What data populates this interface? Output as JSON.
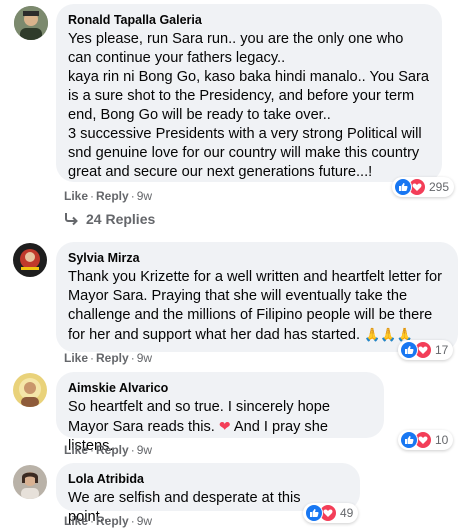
{
  "colors": {
    "bubble": "#f0f2f5",
    "meta_text": "#65676b",
    "like_blue": "#1877f2",
    "love_red": "#f33e58"
  },
  "comments": [
    {
      "author": "Ronald Tapalla Galeria",
      "text": "Yes please, run Sara run.. you are the only one who can continue your fathers legacy..\nkaya rin ni Bong Go, kaso baka hindi manalo.. You Sara is a sure shot to the Presidency, and before your term end, Bong Go will be ready to take over..\n3 successive Presidents with a very strong Political will snd genuine love for our country will make this country great and secure our next generations future...!",
      "like_label": "Like",
      "reply_label": "Reply",
      "age": "9w",
      "reaction_count": "295",
      "replies_label": "24 Replies",
      "avatar_icon": "profile-photo"
    },
    {
      "author": "Sylvia Mirza",
      "text": "Thank you Krizette for a well written and heartfelt letter for Mayor Sara. Praying that she will eventually take the challenge and the millions of Filipino people will be there for her and support what her dad has started.",
      "emoji": "🙏🙏🙏",
      "like_label": "Like",
      "reply_label": "Reply",
      "age": "9w",
      "reaction_count": "17",
      "avatar_icon": "profile-photo"
    },
    {
      "author": "Aimskie Alvarico",
      "text": "So heartfelt and so true. I sincerely hope Mayor Sara reads this.",
      "text_after": "And I pray she listens.",
      "emoji": "❤",
      "like_label": "Like",
      "reply_label": "Reply",
      "age": "9w",
      "reaction_count": "10",
      "avatar_icon": "profile-photo"
    },
    {
      "author": "Lola Atribida",
      "text": "We are selfish and desperate at this point...",
      "like_label": "Like",
      "reply_label": "Reply",
      "age": "9w",
      "reaction_count": "49",
      "avatar_icon": "profile-photo"
    }
  ]
}
